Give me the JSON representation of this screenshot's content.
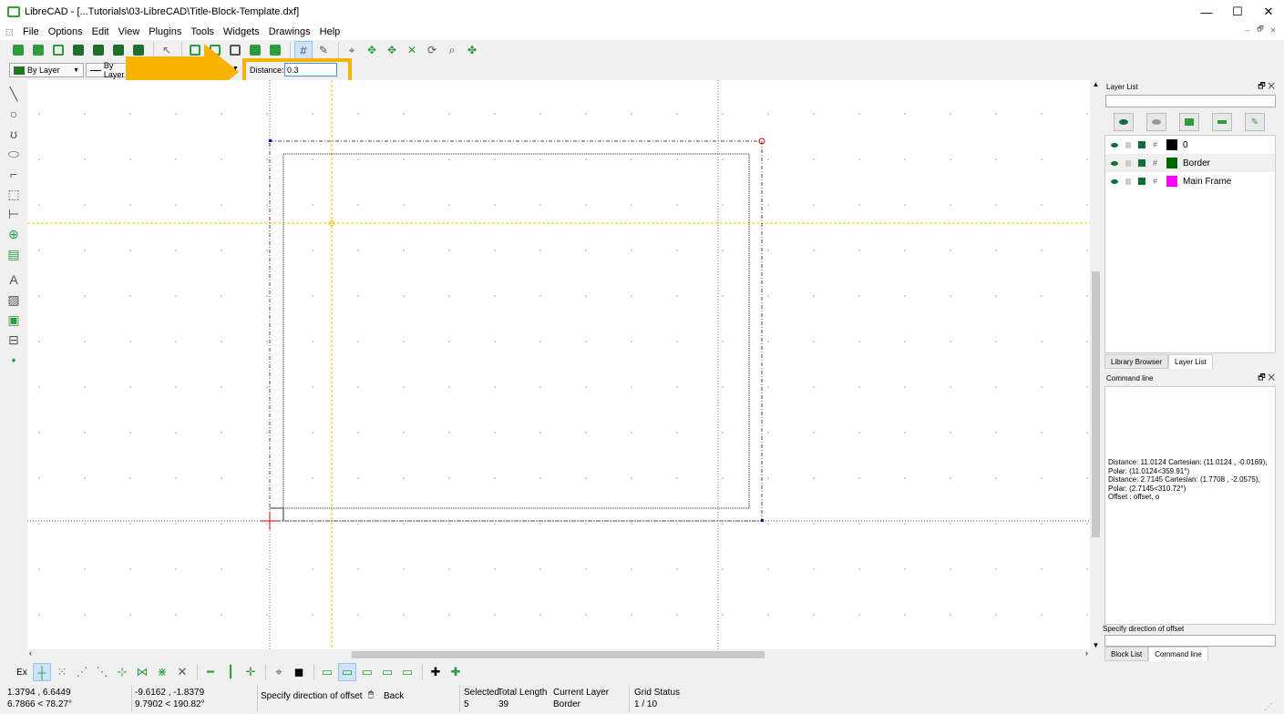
{
  "window": {
    "title": "LibreCAD - [...Tutorials\\03-LibreCAD\\Title-Block-Template.dxf]",
    "controls": {
      "minimize": "—",
      "maximize": "☐",
      "close": "✕"
    },
    "mdi": {
      "minimize": "–",
      "restore": "🗗",
      "close": "✕"
    }
  },
  "menubar": {
    "items": [
      "File",
      "Options",
      "Edit",
      "View",
      "Plugins",
      "Tools",
      "Widgets",
      "Drawings",
      "Help"
    ]
  },
  "property_toolbar": {
    "color": "By Layer",
    "linetype": "By Layer",
    "distance_label": "Distance:",
    "distance_value": "0.3"
  },
  "layer_list": {
    "title": "Layer List",
    "layers": [
      {
        "name": "0",
        "color": "#000000"
      },
      {
        "name": "Border",
        "color": "#006400"
      },
      {
        "name": "Main Frame",
        "color": "#ff00ff"
      }
    ],
    "tabs": [
      "Library Browser",
      "Layer List"
    ]
  },
  "command_line": {
    "title": "Command line",
    "history": [
      "Distance: 11.0124 Cartesian: (11.0124 , -0.0169),",
      "Polar: (11.0124<359.91°)",
      "Distance: 2.7145 Cartesian: (1.7708 , -2.0575),",
      "Polar: (2.7145<310.72°)",
      "Offset : offset, o"
    ],
    "prompt": "Specify direction of offset",
    "tabs": [
      "Block List",
      "Command line"
    ]
  },
  "snap_toolbar": {
    "exclusive_label": "Ex"
  },
  "status": {
    "abs_coord": "1.3794 , 6.6449",
    "abs_polar": "6.7866 < 78.27°",
    "rel_coord": "-9.6162 , -1.8379",
    "rel_polar": "9.7902 < 190.82°",
    "prompt": "Specify direction of offset",
    "back_label": "Back",
    "selected_label": "Selected",
    "selected_value": "5",
    "total_length_label": "Total Length",
    "total_length_value": "39",
    "current_layer_label": "Current Layer",
    "current_layer_value": "Border",
    "grid_status_label": "Grid Status",
    "grid_status_value": "1 / 10"
  },
  "colors": {
    "highlight": "#f8b300",
    "tool_green": "#2e9b3f",
    "crosshair": "#e8c500"
  }
}
